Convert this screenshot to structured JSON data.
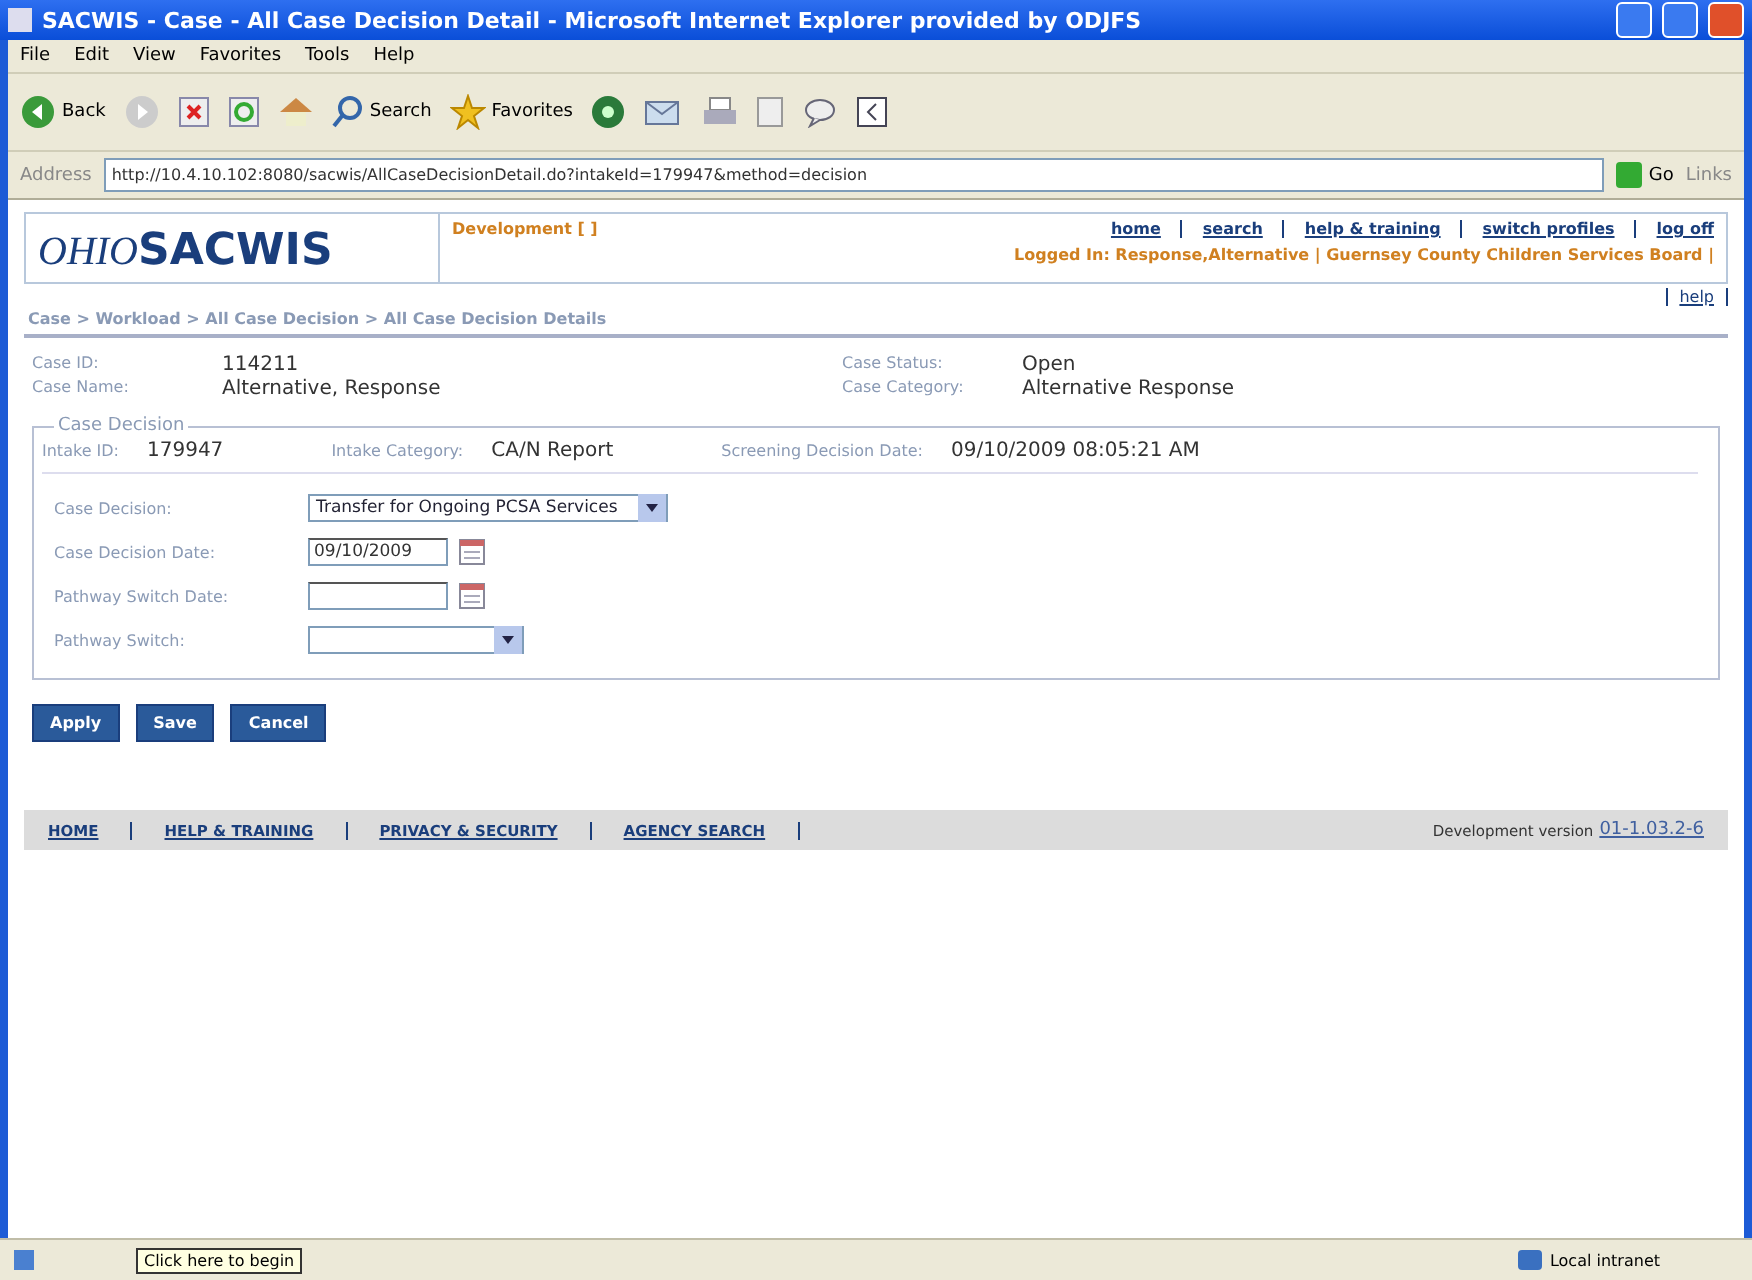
{
  "window": {
    "title": "SACWIS - Case - All Case Decision Detail - Microsoft Internet Explorer provided by ODJFS"
  },
  "menu": [
    "File",
    "Edit",
    "View",
    "Favorites",
    "Tools",
    "Help"
  ],
  "toolbar": [
    {
      "kind": "back",
      "label": "Back"
    },
    {
      "kind": "forward"
    },
    {
      "kind": "stop"
    },
    {
      "kind": "refresh"
    },
    {
      "kind": "home"
    },
    {
      "kind": "search",
      "label": "Search"
    },
    {
      "kind": "favorites",
      "label": "Favorites"
    },
    {
      "kind": "media"
    },
    {
      "kind": "mail"
    },
    {
      "kind": "print"
    },
    {
      "kind": "edit"
    },
    {
      "kind": "discuss"
    },
    {
      "kind": "messenger"
    }
  ],
  "address": {
    "label": "Address",
    "value": "http://10.4.10.102:8080/sacwis/AllCaseDecisionDetail.do?intakeId=179947&method=decision",
    "go": "Go",
    "links": "Links"
  },
  "header": {
    "logo_prefix": "OHIO",
    "logo": "SACWIS",
    "environment": "Development [ ]",
    "nav": [
      "home",
      "search",
      "help & training",
      "switch profiles",
      "log off"
    ],
    "logged_in": "Logged In: Response,Alternative | Guernsey County Children Services Board |",
    "help": "help"
  },
  "breadcrumb": "Case > Workload > All Case Decision > All Case Decision Details",
  "case_info": [
    {
      "label": "Case ID:",
      "value": "114211"
    },
    {
      "label": "Case Status:",
      "value": "Open"
    },
    {
      "label": "Case Name:",
      "value": "Alternative, Response"
    },
    {
      "label": "Case Category:",
      "value": "Alternative Response"
    }
  ],
  "case_decision": {
    "legend": "Case Decision",
    "summary": [
      {
        "label": "Intake ID:",
        "value": "179947"
      },
      {
        "label": "Intake Category:",
        "value": "CA/N Report"
      },
      {
        "label": "Screening Decision Date:",
        "value": "09/10/2009 08:05:21 AM"
      }
    ],
    "fields": [
      {
        "kind": "select",
        "label": "Case Decision:",
        "value": "Transfer for Ongoing PCSA Services"
      },
      {
        "kind": "date",
        "label": "Case Decision Date:",
        "value": "09/10/2009"
      },
      {
        "kind": "date",
        "label": "Pathway Switch Date:"
      },
      {
        "kind": "select",
        "label": "Pathway Switch:"
      }
    ]
  },
  "buttons": [
    "Apply",
    "Save",
    "Cancel"
  ],
  "footer": {
    "links": [
      "HOME",
      "HELP & TRAINING",
      "PRIVACY & SECURITY",
      "AGENCY SEARCH"
    ],
    "version_label": "Development version",
    "version": "01-1.03.2-6"
  },
  "status_bar": {
    "tooltip": "Click here to begin",
    "zone": "Local intranet"
  }
}
